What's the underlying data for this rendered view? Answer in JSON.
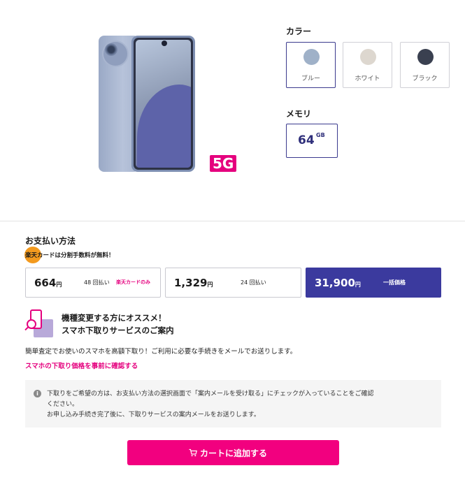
{
  "product": {
    "badge": "5G"
  },
  "color": {
    "label": "カラー",
    "options": [
      {
        "name": "ブルー",
        "swatch": "#9fb1c8",
        "selected": true
      },
      {
        "name": "ホワイト",
        "swatch": "#ddd7cf",
        "selected": false
      },
      {
        "name": "ブラック",
        "swatch": "#3a4050",
        "selected": false
      }
    ]
  },
  "memory": {
    "label": "メモリ",
    "value": "64",
    "unit": "GB"
  },
  "payment": {
    "title": "お支払い方法",
    "card_note": "楽天カードは分割手数料が無料！",
    "options": [
      {
        "price": "664",
        "yen": "円",
        "count": "48 回払い",
        "tag": "楽天カードのみ",
        "selected": false
      },
      {
        "price": "1,329",
        "yen": "円",
        "count": "24 回払い",
        "tag": "",
        "selected": false
      },
      {
        "price": "31,900",
        "yen": "円",
        "count": "一括価格",
        "tag": "",
        "selected": true
      }
    ]
  },
  "trade_in": {
    "title_line1": "機種変更する方にオススメ！",
    "title_line2": "スマホ下取りサービスのご案内",
    "description": "簡単査定でお使いのスマホを高額下取り！ご利用に必要な手続きをメールでお送りします。",
    "link": "スマホの下取り価格を事前に確認する"
  },
  "notice": {
    "icon": "i",
    "line1": "下取りをご希望の方は、お支払い方法の選択画面で「案内メールを受け取る」にチェックが入っていることをご確認",
    "line2": "ください。",
    "line3": "お申し込み手続き完了後に、下取りサービスの案内メールをお送りします。"
  },
  "cart": {
    "label": "カートに追加する"
  },
  "colors": {
    "accent": "#e5007e",
    "selected_border": "#3b3a8e",
    "selected_fill": "#3b3a9e"
  }
}
